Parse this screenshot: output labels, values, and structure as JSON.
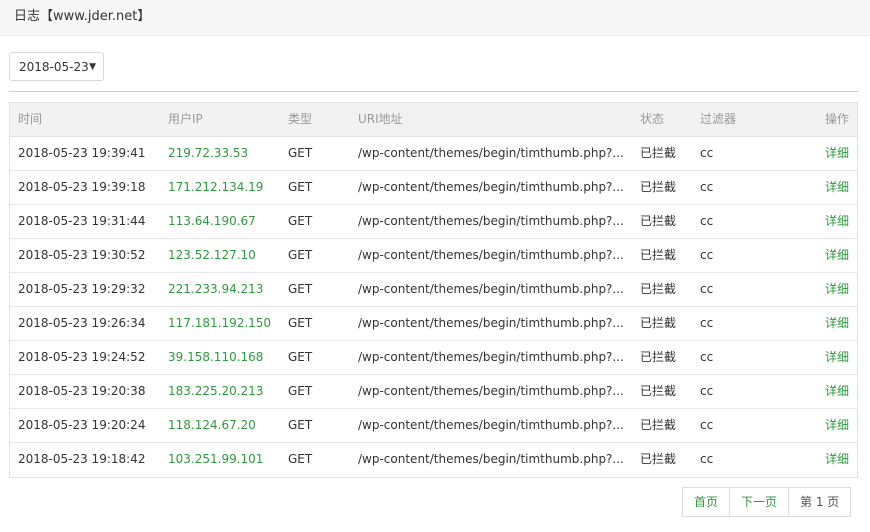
{
  "header": {
    "title": "日志【www.jder.net】"
  },
  "filter": {
    "date_value": "2018-05-23",
    "caret": "▼"
  },
  "table": {
    "columns": {
      "time": "时间",
      "ip": "用户IP",
      "type": "类型",
      "uri": "URI地址",
      "status": "状态",
      "filter": "过滤器",
      "op": "操作"
    },
    "rows": [
      {
        "time": "2018-05-23 19:39:41",
        "ip": "219.72.33.53",
        "type": "GET",
        "uri": "/wp-content/themes/begin/timthumb.php?...",
        "status": "已拦截",
        "filter": "cc",
        "op": "详细"
      },
      {
        "time": "2018-05-23 19:39:18",
        "ip": "171.212.134.19",
        "type": "GET",
        "uri": "/wp-content/themes/begin/timthumb.php?...",
        "status": "已拦截",
        "filter": "cc",
        "op": "详细"
      },
      {
        "time": "2018-05-23 19:31:44",
        "ip": "113.64.190.67",
        "type": "GET",
        "uri": "/wp-content/themes/begin/timthumb.php?...",
        "status": "已拦截",
        "filter": "cc",
        "op": "详细"
      },
      {
        "time": "2018-05-23 19:30:52",
        "ip": "123.52.127.10",
        "type": "GET",
        "uri": "/wp-content/themes/begin/timthumb.php?...",
        "status": "已拦截",
        "filter": "cc",
        "op": "详细"
      },
      {
        "time": "2018-05-23 19:29:32",
        "ip": "221.233.94.213",
        "type": "GET",
        "uri": "/wp-content/themes/begin/timthumb.php?...",
        "status": "已拦截",
        "filter": "cc",
        "op": "详细"
      },
      {
        "time": "2018-05-23 19:26:34",
        "ip": "117.181.192.150",
        "type": "GET",
        "uri": "/wp-content/themes/begin/timthumb.php?...",
        "status": "已拦截",
        "filter": "cc",
        "op": "详细"
      },
      {
        "time": "2018-05-23 19:24:52",
        "ip": "39.158.110.168",
        "type": "GET",
        "uri": "/wp-content/themes/begin/timthumb.php?...",
        "status": "已拦截",
        "filter": "cc",
        "op": "详细"
      },
      {
        "time": "2018-05-23 19:20:38",
        "ip": "183.225.20.213",
        "type": "GET",
        "uri": "/wp-content/themes/begin/timthumb.php?...",
        "status": "已拦截",
        "filter": "cc",
        "op": "详细"
      },
      {
        "time": "2018-05-23 19:20:24",
        "ip": "118.124.67.20",
        "type": "GET",
        "uri": "/wp-content/themes/begin/timthumb.php?...",
        "status": "已拦截",
        "filter": "cc",
        "op": "详细"
      },
      {
        "time": "2018-05-23 19:18:42",
        "ip": "103.251.99.101",
        "type": "GET",
        "uri": "/wp-content/themes/begin/timthumb.php?...",
        "status": "已拦截",
        "filter": "cc",
        "op": "详细"
      }
    ]
  },
  "pagination": {
    "first": "首页",
    "next": "下一页",
    "page_info": "第 1 页"
  },
  "colors": {
    "accent": "#2e9a3e",
    "header_bg": "#f7f7f7"
  }
}
